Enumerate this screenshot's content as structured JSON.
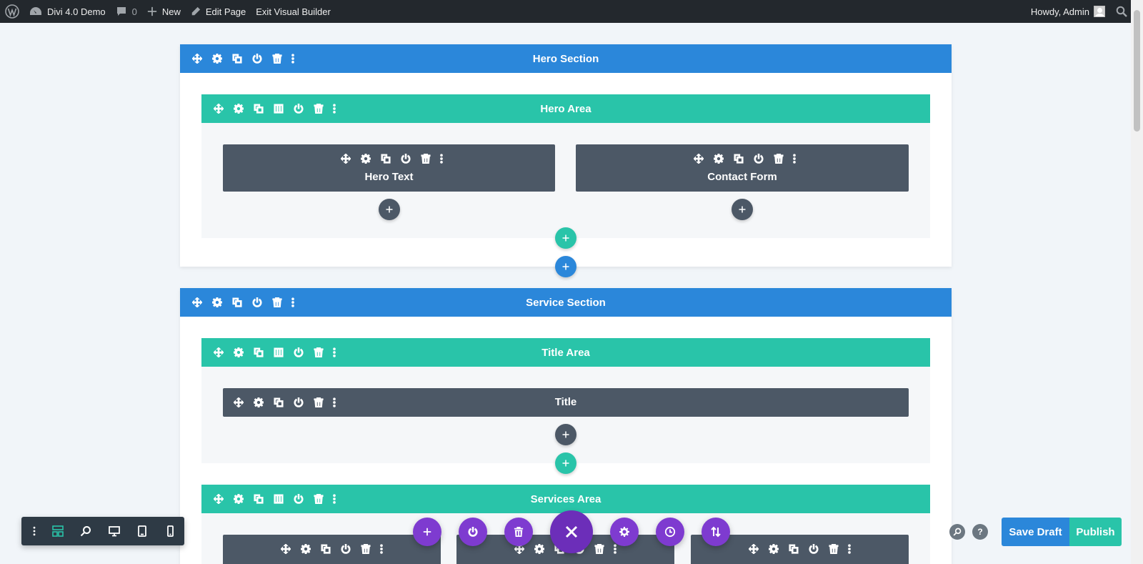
{
  "adminbar": {
    "site_name": "Divi 4.0 Demo",
    "comments_count": "0",
    "new_label": "New",
    "edit_page_label": "Edit Page",
    "exit_label": "Exit Visual Builder",
    "howdy_label": "Howdy, Admin"
  },
  "sections": [
    {
      "title": "Hero Section",
      "rows": [
        {
          "title": "Hero Area",
          "modules": [
            "Hero Text",
            "Contact Form"
          ]
        }
      ]
    },
    {
      "title": "Service Section",
      "rows": [
        {
          "title": "Title Area",
          "modules": [
            "Title"
          ]
        },
        {
          "title": "Services Area",
          "modules": [
            "",
            "",
            ""
          ]
        }
      ]
    }
  ],
  "bottom_bar": {
    "save_draft_label": "Save Draft",
    "publish_label": "Publish",
    "help_label": "?"
  },
  "colors": {
    "section": "#2b87da",
    "row": "#29c4a9",
    "module": "#4c5866",
    "page_settings": "#7e3bd0",
    "admin_bar": "#23282d"
  },
  "icons": [
    "move-icon",
    "gear-icon",
    "duplicate-icon",
    "columns-icon",
    "power-icon",
    "trash-icon",
    "more-icon",
    "chevron-up-icon",
    "plus-icon",
    "close-icon",
    "history-icon",
    "portability-icon",
    "wireframe-icon",
    "zoom-icon",
    "desktop-icon",
    "tablet-icon",
    "phone-icon",
    "search-icon",
    "help-icon"
  ]
}
